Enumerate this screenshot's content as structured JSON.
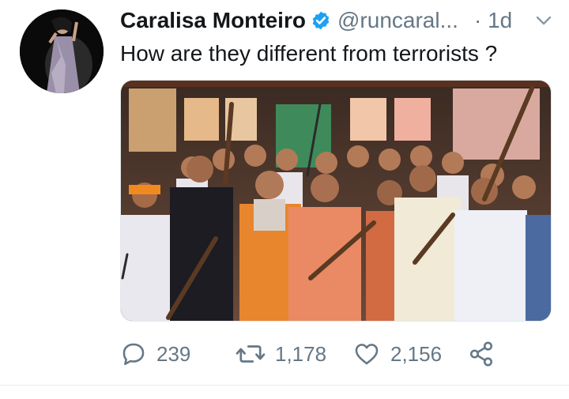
{
  "tweet": {
    "author_name": "Caralisa Monteiro",
    "handle": "@runcaral...",
    "time": "· 1d",
    "text": "How are they different from terrorists ?",
    "avatar_icon": "profile-photo",
    "verified_icon": "verified-badge-icon",
    "media_description_icon": "group-photo-with-rifles"
  },
  "actions": {
    "reply_count": "239",
    "retweet_count": "1,178",
    "like_count": "2,156"
  },
  "colors": {
    "accent": "#1da1f2",
    "secondary_text": "#657786",
    "primary_text": "#14171a"
  }
}
